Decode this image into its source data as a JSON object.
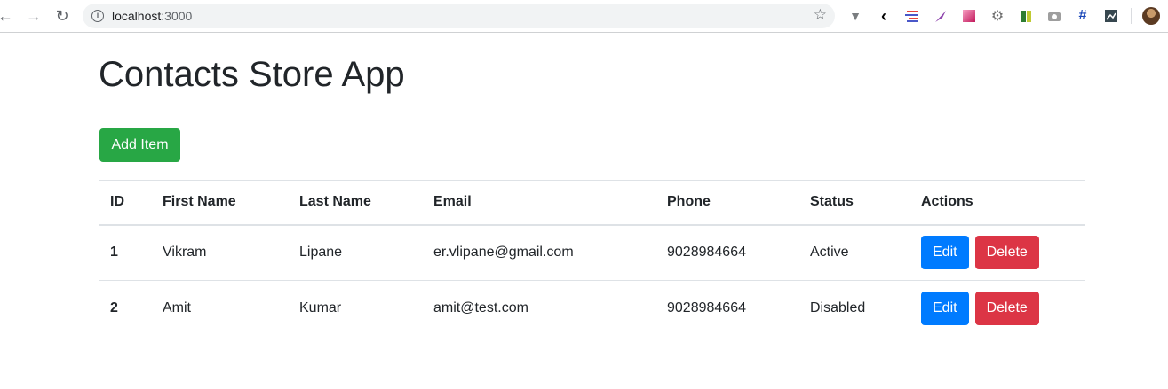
{
  "browser": {
    "url_host": "localhost",
    "url_port": ":3000",
    "extensions": [
      "vue-devtools-icon",
      "arrow-icon",
      "list-icon",
      "feather-icon",
      "gradient-icon",
      "gear-icon",
      "battery-icon",
      "camera-icon",
      "grid-icon",
      "image-icon"
    ]
  },
  "page": {
    "title": "Contacts Store App",
    "add_button": "Add Item"
  },
  "table": {
    "headers": [
      "ID",
      "First Name",
      "Last Name",
      "Email",
      "Phone",
      "Status",
      "Actions"
    ],
    "rows": [
      {
        "id": "1",
        "first_name": "Vikram",
        "last_name": "Lipane",
        "email": "er.vlipane@gmail.com",
        "phone": "9028984664",
        "status": "Active",
        "edit": "Edit",
        "delete": "Delete"
      },
      {
        "id": "2",
        "first_name": "Amit",
        "last_name": "Kumar",
        "email": "amit@test.com",
        "phone": "9028984664",
        "status": "Disabled",
        "edit": "Edit",
        "delete": "Delete"
      }
    ]
  },
  "colors": {
    "success": "#28a745",
    "primary": "#007bff",
    "danger": "#dc3545"
  }
}
